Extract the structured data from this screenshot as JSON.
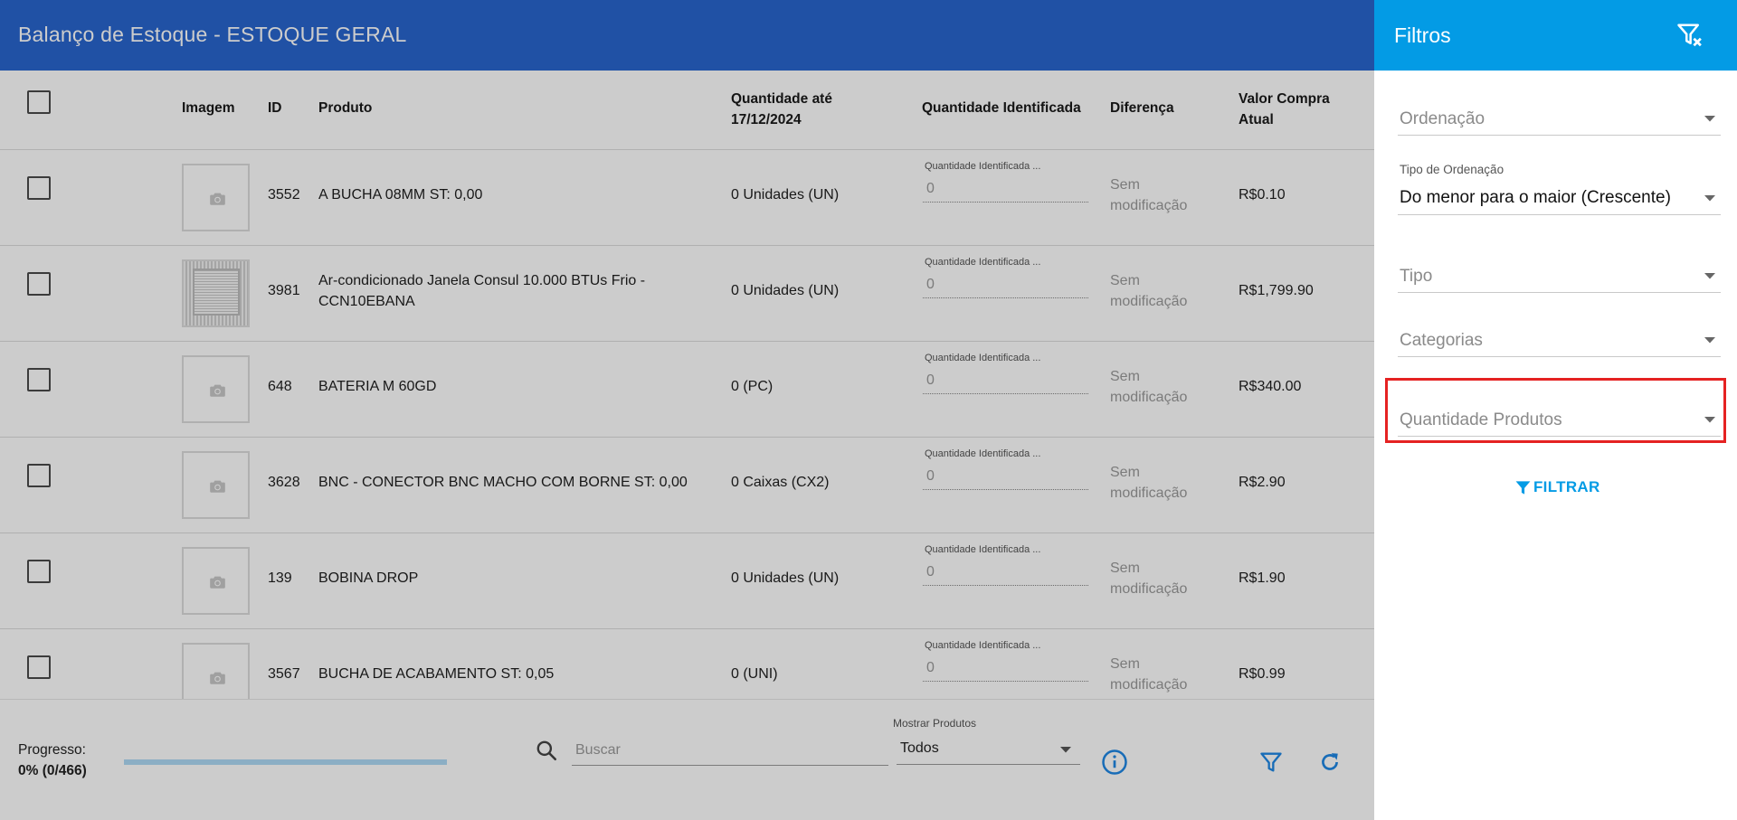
{
  "header": {
    "title": "Balanço de Estoque - ESTOQUE GERAL"
  },
  "table": {
    "columns": {
      "image": "Imagem",
      "id": "ID",
      "product": "Produto",
      "qty_until_line1": "Quantidade até",
      "qty_until_line2": "17/12/2024",
      "qty_identified": "Quantidade Identificada",
      "difference": "Diferença",
      "price_line1": "Valor Compra",
      "price_line2": "Atual"
    },
    "input_label": "Quantidade Identificada ...",
    "rows": [
      {
        "id": "3552",
        "product": "A BUCHA 08MM ST: 0,00",
        "product2": "",
        "qty": "0 Unidades (UN)",
        "identified": "0",
        "dif1": "Sem",
        "dif2": "modificação",
        "price": "R$0.10",
        "image": "camera"
      },
      {
        "id": "3981",
        "product": "Ar-condicionado Janela Consul 10.000 BTUs Frio -",
        "product2": "CCN10EBANA",
        "qty": "0 Unidades (UN)",
        "identified": "0",
        "dif1": "Sem",
        "dif2": "modificação",
        "price": "R$1,799.90",
        "image": "photo"
      },
      {
        "id": "648",
        "product": "BATERIA M 60GD",
        "product2": "",
        "qty": "0 (PC)",
        "identified": "0",
        "dif1": "Sem",
        "dif2": "modificação",
        "price": "R$340.00",
        "image": "camera"
      },
      {
        "id": "3628",
        "product": "BNC - CONECTOR BNC MACHO COM BORNE ST: 0,00",
        "product2": "",
        "qty": "0 Caixas (CX2)",
        "identified": "0",
        "dif1": "Sem",
        "dif2": "modificação",
        "price": "R$2.90",
        "image": "camera"
      },
      {
        "id": "139",
        "product": "BOBINA DROP",
        "product2": "",
        "qty": "0 Unidades (UN)",
        "identified": "0",
        "dif1": "Sem",
        "dif2": "modificação",
        "price": "R$1.90",
        "image": "camera"
      },
      {
        "id": "3567",
        "product": "BUCHA DE ACABAMENTO ST: 0,05",
        "product2": "",
        "qty": "0 (UNI)",
        "identified": "0",
        "dif1": "Sem",
        "dif2": "modificação",
        "price": "R$0.99",
        "image": "camera"
      }
    ]
  },
  "footer": {
    "progress_label": "Progresso:",
    "progress_value": "0% (0/466)",
    "progress_fraction": 0,
    "search_placeholder": "Buscar",
    "show_label": "Mostrar Produtos",
    "show_value": "Todos"
  },
  "filters": {
    "title": "Filtros",
    "ordering_placeholder": "Ordenação",
    "order_type_label": "Tipo de Ordenação",
    "order_type_value": "Do menor para o maior (Crescente)",
    "type_placeholder": "Tipo",
    "categories_placeholder": "Categorias",
    "quantity_placeholder": "Quantidade Produtos",
    "apply_label": "FILTRAR"
  },
  "colors": {
    "header_blue": "#2866cf",
    "panel_blue": "#039be5",
    "highlight_red": "#e52222",
    "accent": "#2196f3"
  },
  "icons": [
    "camera-icon",
    "search-icon",
    "info-icon",
    "filter-icon",
    "refresh-icon",
    "clear-filter-icon",
    "caret-down-icon",
    "filter-funnel-icon"
  ]
}
